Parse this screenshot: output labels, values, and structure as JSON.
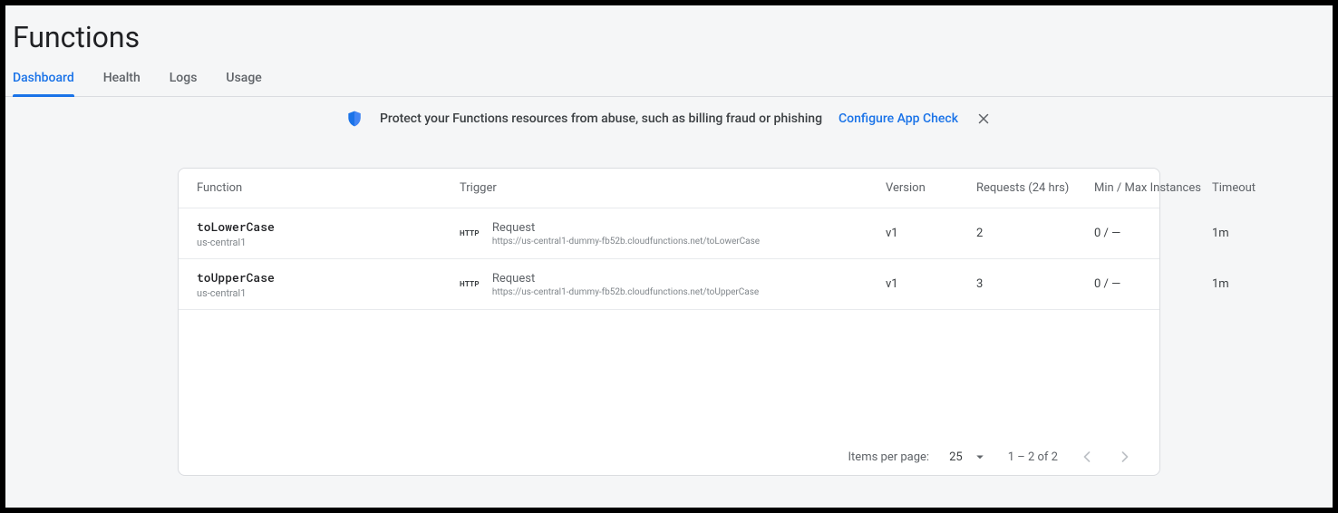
{
  "header": {
    "title": "Functions"
  },
  "tabs": [
    {
      "label": "Dashboard",
      "active": true
    },
    {
      "label": "Health",
      "active": false
    },
    {
      "label": "Logs",
      "active": false
    },
    {
      "label": "Usage",
      "active": false
    }
  ],
  "banner": {
    "icon": "shield-icon",
    "message": "Protect your Functions resources from abuse, such as billing fraud or phishing",
    "action": "Configure App Check"
  },
  "table": {
    "columns": [
      "Function",
      "Trigger",
      "Version",
      "Requests (24 hrs)",
      "Min / Max Instances",
      "Timeout"
    ],
    "rows": [
      {
        "name": "toLowerCase",
        "region": "us-central1",
        "trigger_badge": "HTTP",
        "trigger_title": "Request",
        "trigger_url": "https://us-central1-dummy-fb52b.cloudfunctions.net/toLowerCase",
        "version": "v1",
        "requests": "2",
        "instances": "0 / —",
        "timeout": "1m"
      },
      {
        "name": "toUpperCase",
        "region": "us-central1",
        "trigger_badge": "HTTP",
        "trigger_title": "Request",
        "trigger_url": "https://us-central1-dummy-fb52b.cloudfunctions.net/toUpperCase",
        "version": "v1",
        "requests": "3",
        "instances": "0 / —",
        "timeout": "1m"
      }
    ]
  },
  "pager": {
    "items_per_page_label": "Items per page:",
    "items_per_page_value": "25",
    "range": "1 – 2 of 2"
  }
}
